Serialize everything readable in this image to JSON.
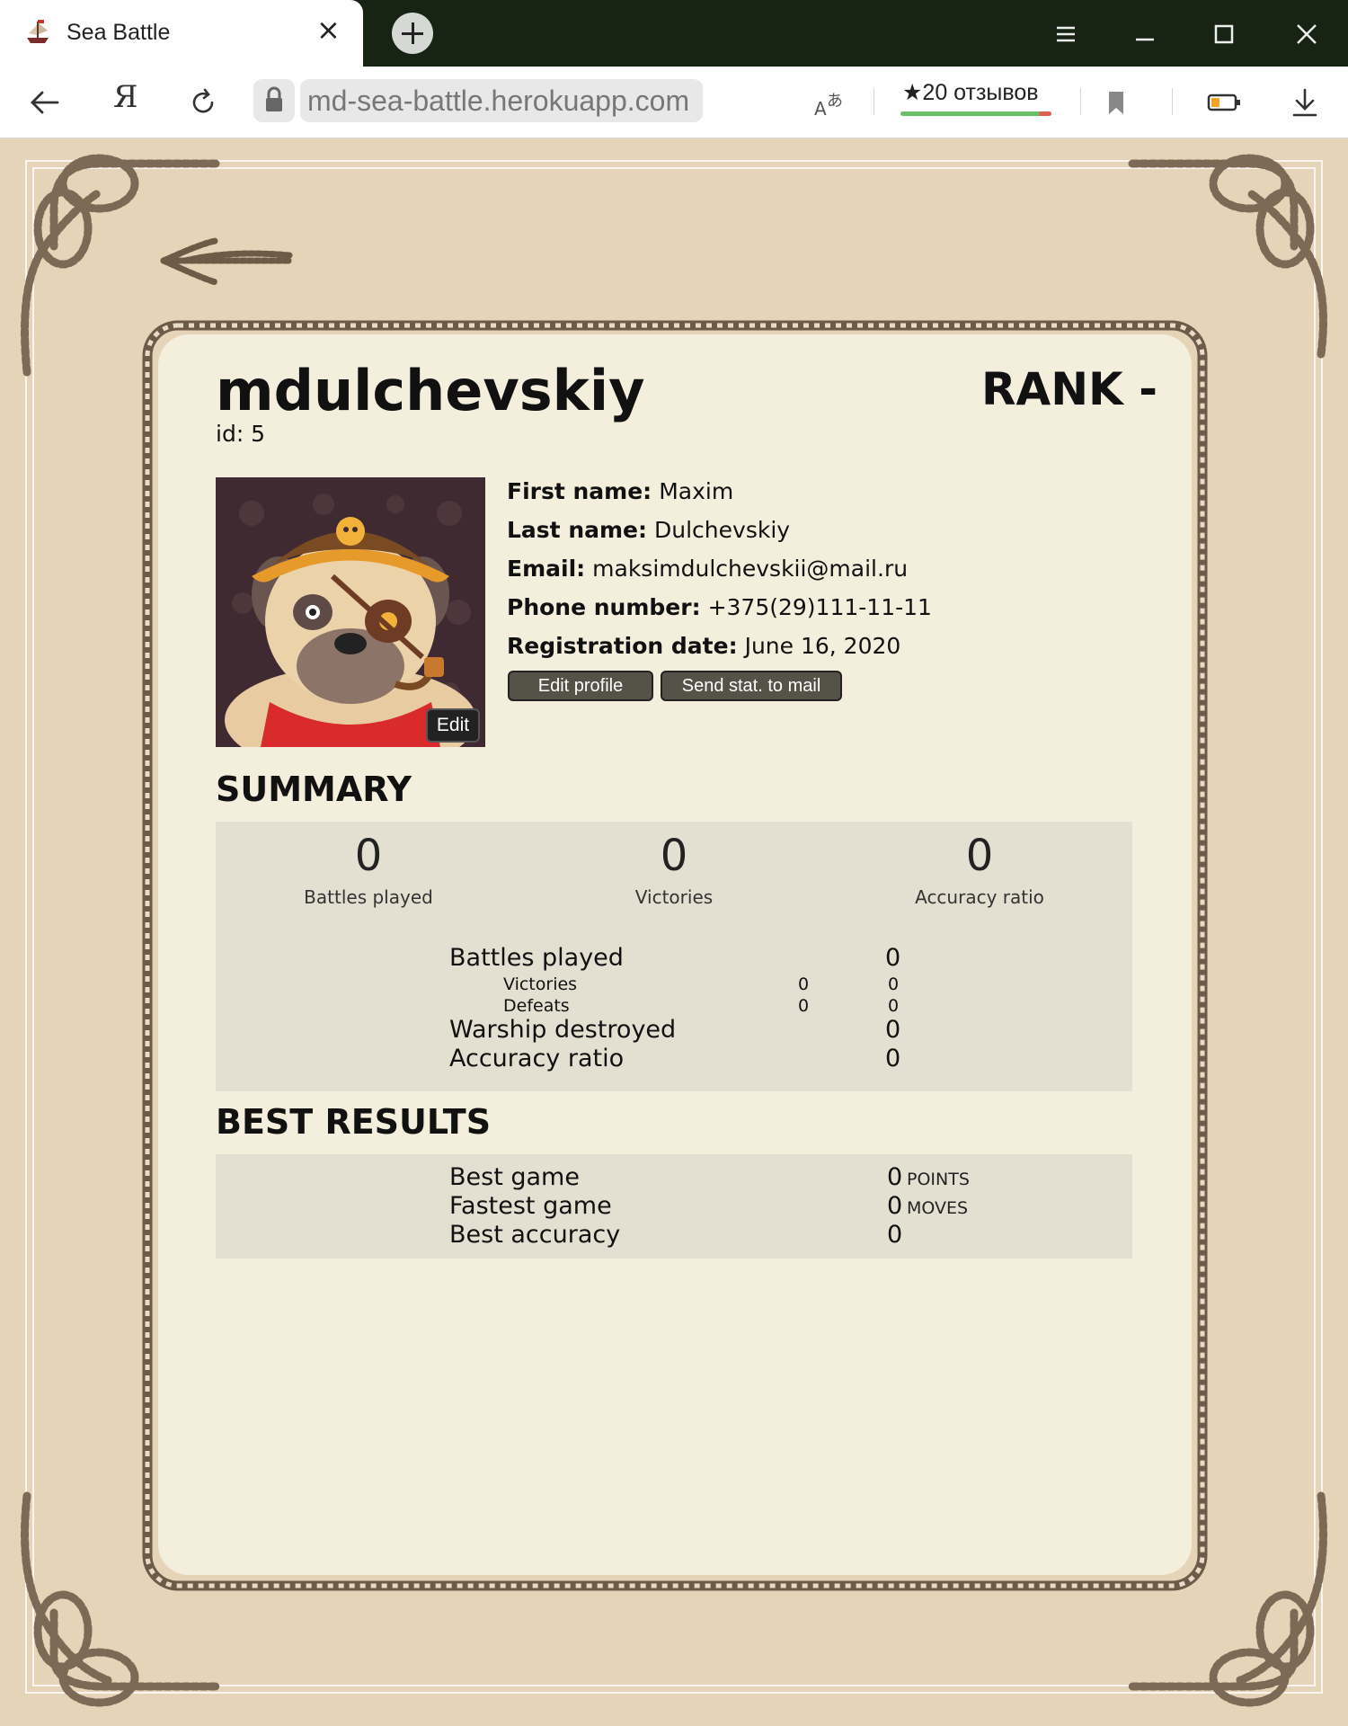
{
  "browser": {
    "tab_title": "Sea Battle",
    "tab_close": "×",
    "ya_label": "Я",
    "address": "md-sea-battle.herokuapp.com",
    "reviews_label": "★20 отзывов"
  },
  "profile": {
    "username": "mdulchevskiy",
    "id_text": "id: 5",
    "rank_text": "RANK -",
    "avatar_edit": "Edit",
    "fields": {
      "first_name_label": "First name:",
      "first_name": "Maxim",
      "last_name_label": "Last name:",
      "last_name": "Dulchevskiy",
      "email_label": "Email:",
      "email": "maksimdulchevskii@mail.ru",
      "phone_label": "Phone number:",
      "phone": "+375(29)111-11-11",
      "reg_label": "Registration date:",
      "reg_date": "June 16, 2020"
    },
    "buttons": {
      "edit_profile": "Edit profile",
      "send_stat": "Send stat. to mail"
    }
  },
  "summary": {
    "title": "SUMMARY",
    "cards": [
      {
        "value": "0",
        "label": "Battles played"
      },
      {
        "value": "0",
        "label": "Victories"
      },
      {
        "value": "0",
        "label": "Accuracy ratio"
      }
    ],
    "rows": {
      "battles_played": {
        "label": "Battles played",
        "value": "0"
      },
      "victories": {
        "label": "Victories",
        "value_a": "0",
        "value_b": "0"
      },
      "defeats": {
        "label": "Defeats",
        "value_a": "0",
        "value_b": "0"
      },
      "warship_destroyed": {
        "label": "Warship destroyed",
        "value": "0"
      },
      "accuracy_ratio": {
        "label": "Accuracy ratio",
        "value": "0"
      }
    }
  },
  "best_results": {
    "title": "BEST RESULTS",
    "rows": {
      "best_game": {
        "label": "Best game",
        "value": "0",
        "unit": "POINTS"
      },
      "fastest_game": {
        "label": "Fastest game",
        "value": "0",
        "unit": "MOVES"
      },
      "best_accuracy": {
        "label": "Best accuracy",
        "value": "0"
      }
    }
  }
}
